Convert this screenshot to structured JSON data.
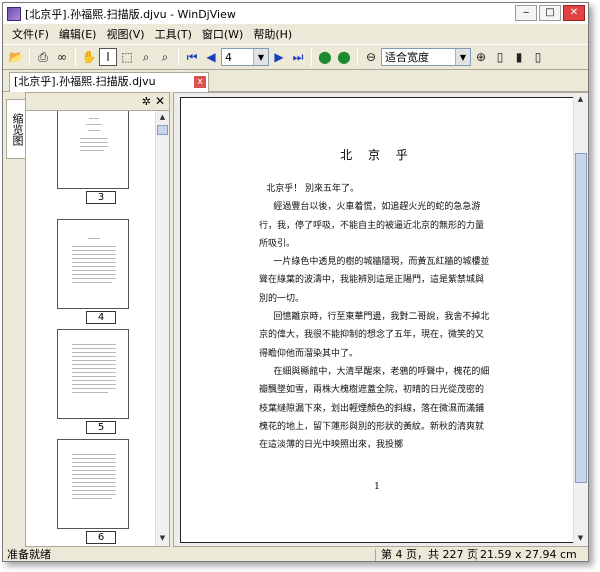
{
  "window": {
    "title": "[北京乎].孙福熙.扫描版.djvu - WinDjView",
    "min": "‒",
    "max": "□",
    "close": "✕"
  },
  "menu": [
    {
      "label": "文件(F)"
    },
    {
      "label": "编辑(E)"
    },
    {
      "label": "视图(V)"
    },
    {
      "label": "工具(T)"
    },
    {
      "label": "窗口(W)"
    },
    {
      "label": "帮助(H)"
    }
  ],
  "toolbar": {
    "page_value": "4",
    "zoom_value": "适合宽度"
  },
  "tab": {
    "label": "[北京乎].孙福熙.扫描版.djvu",
    "close": "x"
  },
  "sidebar": {
    "tab_label": "缩览图",
    "pin": "✲",
    "close": "✕",
    "thumbnails": [
      {
        "label": "3"
      },
      {
        "label": "4"
      },
      {
        "label": "5"
      },
      {
        "label": "6"
      }
    ]
  },
  "page": {
    "title": "北 京 乎",
    "paragraphs": [
      "北京乎！ 別來五年了。",
      "經過豐台以後，火車着慌，如追趕火光的蛇的急急游行，我，停了呼吸，不能自主的被逼近北京的無形的力量所吸引。",
      "一片綠色中透見的樹的城牆隱現，而黃瓦紅牆的城樓並聳在綠葉的波濤中，我能辨別這是正陽門，這是紫禁城與別的一切。",
      "回憶離京時，行至東華門邊，我對二哥說，我舍不掉北京的偉大，我很不能抑制的想念了五年，現在，微笑的又得瞻仰他而溜染其中了。",
      "在細與縣館中，大清早醒來，老鴉的呼聲中，槐花的細瓣飄墜如雪，兩株大槐樹遮蓋全院，初晴的日光從茂密的枝葉縫隙漏下來，划出輕煙顏色的斜線，落在微濕而滿鋪槐花的地上，留下蓮形與別的形狀的黃紋。新秋的清爽就在這淡薄的日光中映照出來，我投擲"
    ],
    "number": "1"
  },
  "status": {
    "ready": "准备就绪",
    "page_info": "第 4 页，共 227 页",
    "size": "21.59 x 27.94 cm"
  }
}
